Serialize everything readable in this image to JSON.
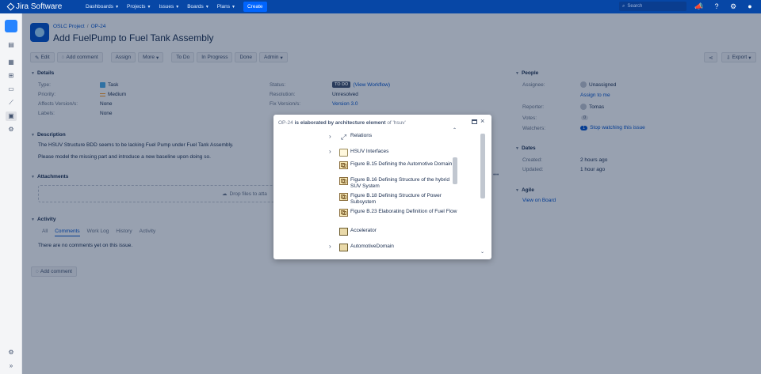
{
  "app": {
    "name": "Jira Software"
  },
  "topnav": {
    "items": [
      "Dashboards",
      "Projects",
      "Issues",
      "Boards",
      "Plans"
    ],
    "create": "Create",
    "search_placeholder": "Search"
  },
  "breadcrumb": {
    "project": "OSLC Project",
    "issue_key": "OP-24"
  },
  "issue": {
    "title": "Add FuelPump to Fuel Tank Assembly"
  },
  "toolbar": {
    "edit": "Edit",
    "add_comment": "Add comment",
    "assign": "Assign",
    "more": "More",
    "to_do": "To Do",
    "in_progress": "In Progress",
    "done": "Done",
    "admin": "Admin",
    "export": "Export"
  },
  "details": {
    "heading": "Details",
    "type_label": "Type:",
    "type_value": "Task",
    "priority_label": "Priority:",
    "priority_value": "Medium",
    "affects_label": "Affects Version/s:",
    "affects_value": "None",
    "labels_label": "Labels:",
    "labels_value": "None",
    "status_label": "Status:",
    "status_value": "TO DO",
    "status_link": "(View Workflow)",
    "resolution_label": "Resolution:",
    "resolution_value": "Unresolved",
    "fix_label": "Fix Version/s:",
    "fix_value": "Version 3.0"
  },
  "description": {
    "heading": "Description",
    "line1": "The HSUV Structure BDD seems to be lacking Fuel Pump under Fuel Tank Assembly.",
    "line2": "Please model the missing part and introduce a new baseline upon doing so."
  },
  "attachments": {
    "heading": "Attachments",
    "drop_text": "Drop files to atta"
  },
  "activity": {
    "heading": "Activity",
    "tabs": [
      "All",
      "Comments",
      "Work Log",
      "History",
      "Activity"
    ],
    "empty": "There are no comments yet on this issue.",
    "add_comment": "Add comment"
  },
  "people": {
    "heading": "People",
    "assignee_label": "Assignee:",
    "assignee_value": "Unassigned",
    "assign_to_me": "Assign to me",
    "reporter_label": "Reporter:",
    "reporter_value": "Tomas",
    "votes_label": "Votes:",
    "votes_value": "0",
    "watchers_label": "Watchers:",
    "watchers_value": "1",
    "watchers_link": "Stop watching this issue"
  },
  "dates": {
    "heading": "Dates",
    "created_label": "Created:",
    "created_value": "2 hours ago",
    "updated_label": "Updated:",
    "updated_value": "1 hour ago"
  },
  "agile": {
    "heading": "Agile",
    "link": "View on Board"
  },
  "dialog": {
    "title_key": "OP-24",
    "title_mid": "is elaborated by architecture element",
    "title_end": "of 'hsuv'",
    "tree": [
      {
        "label": "Relations",
        "icon": "relations-icon",
        "expandable": true
      },
      {
        "label": "HSUV Interfaces",
        "icon": "folder-icon",
        "expandable": true
      },
      {
        "label": "Figure B.15 Defining the Automotive Domain",
        "icon": "diagram-icon",
        "expandable": false
      },
      {
        "label": "Figure B.16 Defining Structure of the hybrid SUV System",
        "icon": "diagram-icon",
        "expandable": false
      },
      {
        "label": "Figure B.18 Defining Structure of Power Subsystem",
        "icon": "diagram-icon",
        "expandable": false
      },
      {
        "label": "Figure B.23 Elaborating Definition of Fuel Flow",
        "icon": "diagram-icon",
        "expandable": false
      },
      {
        "label": "Accelerator",
        "icon": "block-icon",
        "expandable": false
      },
      {
        "label": "AutomotiveDomain",
        "icon": "block-icon",
        "expandable": true
      }
    ]
  }
}
